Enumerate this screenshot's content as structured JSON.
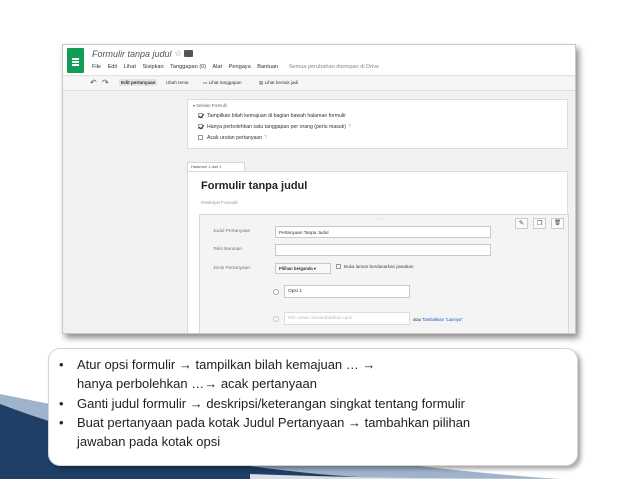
{
  "app": {
    "doc_title": "Formulir tanpa judul",
    "star": "☆",
    "menu": [
      "File",
      "Edit",
      "Lihat",
      "Sisipkan",
      "Tanggapan (0)",
      "Alat",
      "Pengaya",
      "Bantuan"
    ],
    "saved_status": "Semua perubahan disimpan di Drive"
  },
  "toolbar": {
    "undo": "↶",
    "redo": "↷",
    "edit_questions": "Edit pertanyaan",
    "change_theme": "Ubah tema",
    "view_responses": "Lihat tanggapan",
    "view_live_form": "Lihat bentuk jadi"
  },
  "form_settings": {
    "title": "Setelan Formulir",
    "options": [
      {
        "label": "Tampilkan bilah kemajuan di bagian bawah halaman formulir",
        "checked": true,
        "help": ""
      },
      {
        "label": "Hanya perbolehkan satu tanggapan per orang (perlu masuk)",
        "checked": true,
        "help": "?"
      },
      {
        "label": "Acak urutan pertanyaan",
        "checked": false,
        "help": "?"
      }
    ]
  },
  "page_label": "Halaman 1 dari 1",
  "form": {
    "title": "Formulir tanpa judul",
    "description_placeholder": "Deskripsi Formulir"
  },
  "question": {
    "drag_handle": "::::",
    "edit_icon": "✎",
    "copy_icon": "❐",
    "delete_icon": "🗑",
    "title_label": "Judul Pertanyaan",
    "title_value": "Pertanyaan Tanpa Judul",
    "help_label": "Teks Bantuan",
    "help_value": "",
    "type_label": "Jenis Pertanyaan",
    "type_value": "Pilihan berganda",
    "type_arrow": "▾",
    "goto_page_label": "Buka laman berdasarkan jawaban",
    "option1": "Opsi 1",
    "add_option_placeholder": "Klik untuk menambahkan opsi",
    "add_other_prefix": "atau",
    "add_other_link": "Tambahkan \"Lainnya\""
  },
  "bullets": [
    {
      "marker": "•",
      "lines": [
        "Atur opsi formulir → tampilkan bilah kemajuan … →",
        "hanya perbolehkan …→ acak pertanyaan"
      ]
    },
    {
      "marker": "•",
      "lines": [
        "Ganti judul formulir → deskripsi/keterangan singkat tentang formulir"
      ]
    },
    {
      "marker": "•",
      "lines": [
        "Buat pertanyaan pada kotak Judul Pertanyaan → tambahkan pilihan",
        "jawaban pada kotak opsi"
      ]
    }
  ],
  "colors": {
    "forms_green": "#0f9d58",
    "swoosh_dark": "#1f3f66",
    "swoosh_light": "#9fb4cc",
    "link_blue": "#1155cc"
  }
}
